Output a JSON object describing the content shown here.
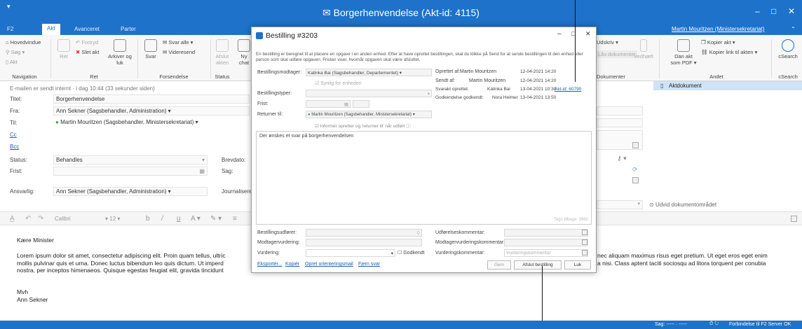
{
  "window": {
    "title": "Borgerhenvendelse (Akt-id: 4115)",
    "minimize": "‒",
    "maximize": "□",
    "close": "✕"
  },
  "tabs": [
    "F2",
    "Akt",
    "Avanceret",
    "Parter"
  ],
  "user": "Martin Mouritzen (Ministersekretariat)",
  "ribbon": {
    "navigation": {
      "label": "Navigation",
      "items": [
        "Hovedvindue",
        "Søg",
        "Akt"
      ]
    },
    "ret": {
      "label": "Ret",
      "items": [
        "Ret",
        "Fortryd",
        "Slet akt",
        "Arkiver og luk"
      ]
    },
    "forsendelse": {
      "label": "Forsendelse",
      "items": [
        "Svar",
        "Svar alle",
        "Videresend"
      ]
    },
    "status": {
      "label": "Status",
      "items": [
        "Afslut akten"
      ]
    },
    "partial": [
      "Ny chat"
    ],
    "dokumenter": {
      "label": "Dokumenter",
      "items": [
        "Udskriv",
        "Lås dokumenter",
        "Vedhæft"
      ]
    },
    "andet": {
      "label": "Andet",
      "items": [
        "Dan akt som PDF",
        "Kopier akt",
        "Kopier link til akten"
      ]
    },
    "csearch": {
      "label": "cSearch",
      "item": "cSearch"
    }
  },
  "email": {
    "sent_info": "E-mailen er sendt internt · i dag 10:44 (33 sekunder siden)",
    "titel_label": "Titel:",
    "titel": "Borgerhenvendelse",
    "fra_label": "Fra:",
    "fra": "Ann Sekner (Sagsbehandler, Administration)",
    "til_label": "Til:",
    "til": "Martin Mouritzen (Sagsbehandler, Ministersekretariat)",
    "cc_label": "Cc",
    "bcc_label": "Bcc",
    "status_label": "Status:",
    "status": "Behandles",
    "frist_label": "Frist:",
    "brevdato_label": "Brevdato:",
    "sag_label": "Sag:",
    "ansvarlig_label": "Ansvarlig:",
    "ansvarlig": "Ann Sekner (Sagsbehandler, Administration)",
    "journalisering_label": "Journalisere",
    "font": "Calibri",
    "font_size": "12",
    "greeting": "Kære Minister",
    "body_left": "Lorem ipsum dolor sit amet, consectetur adipiscing elit. Proin quam tellus, ultric",
    "body_left2": "mollis pulvinar quis et urna. Donec luctus bibendum leo quis dictum. Ut imperd",
    "body_left3": "nostra, per inceptos himenaeos. Quisque egestas feugiat elit, gravida tincidunt",
    "body_right": "nec aliquam maximus risus eget pretium. Ut eget eros eget enim",
    "body_right2": "a nisi. Class aptent taciti sociosqu ad litora torquent per conubia",
    "sign1": "Mvh",
    "sign2": "Ann Sekner"
  },
  "rightpane": {
    "doc": "Aktdokument",
    "expand": "Udvid dokumentområdet"
  },
  "dialog": {
    "title": "Bestilling #3203",
    "info": "En bestilling er beregnet til at placere en opgave i en anden enhed. Efter at have oprettet bestillingen, skal du klikke på Send for at sende bestillingen til den enhed eller person som skal udføre opgaven. Fristen viser, hvornår opgaven skal være afsluttet.",
    "modtager_label": "Bestillingsmodtager:",
    "modtager": "Katinka Bai (Sagsbehandler, Departementet)",
    "synlig": "Synlig for enheden",
    "typer_label": "Bestillingstyper:",
    "frist_label": "Frist:",
    "returner_label": "Returner til:",
    "returner": "Martin Mouritzen (Sagsbehandler, Ministersekretariat)",
    "informer": "Informér opretter og 'returner til' når udført",
    "oprettet_label": "Oprettet af:",
    "oprettet_name": "Martin Mouritzen",
    "oprettet_date": "12-04-2021 14:20",
    "sendt_label": "Sendt af:",
    "sendt_name": "Martin Mouritzen",
    "sendt_date": "12-04-2021 14:20",
    "svar_label": "Svarakt oprettet:",
    "svar_name": "Katinka Bai",
    "svar_date": "13-04-2021 10:30",
    "svar_link": "Akt-id: 60790",
    "godk_label": "Godkendelse godkendt:",
    "godk_name": "Nora Helmer",
    "godk_date": "13-04-2021 13:50",
    "message": "Der ønskes et svar på borgerhenvendelsen",
    "counter": "Tegn tilbage: 3960",
    "udforer_label": "Bestillingsudfører:",
    "modtagervurdering_label": "Modtagervurdering:",
    "vurdering_label": "Vurdering:",
    "godkendt": "Godkendt",
    "udforelses_label": "Udførelseskommentar:",
    "modtagervurderingskommentar_label": "Modtagervurderingskommentar:",
    "vurderingskommentar_label": "Vurderingskommentar:",
    "vurderingskommentar_placeholder": "Vurderingskommentar",
    "links": [
      "Eksportér...",
      "Kopiér",
      "Opret orienteringsmail",
      "Fjern svar"
    ],
    "gem": "Gem",
    "afslut": "Afslut bestilling",
    "luk": "Luk"
  },
  "statusbar": {
    "sag": "Sag: ----- · -----",
    "connection": "Forbindelse til F2 Server OK"
  }
}
